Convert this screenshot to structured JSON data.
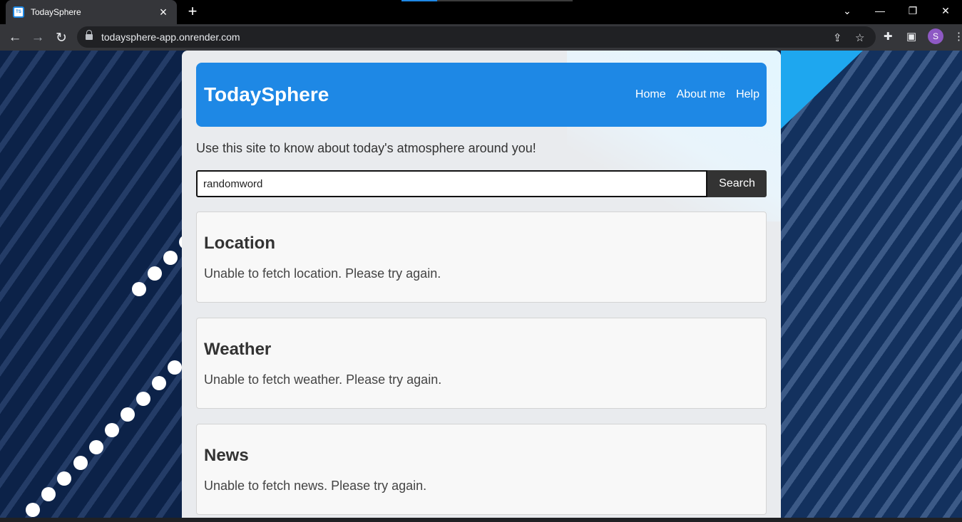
{
  "browser": {
    "tab_title": "TodaySphere",
    "favicon_text": "TS",
    "url": "todaysphere-app.onrender.com",
    "profile_initial": "S"
  },
  "site": {
    "brand": "TodaySphere",
    "nav": [
      "Home",
      "About me",
      "Help"
    ],
    "tagline": "Use this site to know about today's atmosphere around you!",
    "search": {
      "value": "randomword",
      "button": "Search"
    },
    "cards": [
      {
        "title": "Location",
        "message": "Unable to fetch location. Please try again."
      },
      {
        "title": "Weather",
        "message": "Unable to fetch weather. Please try again."
      },
      {
        "title": "News",
        "message": "Unable to fetch news. Please try again."
      }
    ]
  },
  "colors": {
    "header": "#1e88e5",
    "button": "#333333",
    "background": "#0c2248"
  }
}
